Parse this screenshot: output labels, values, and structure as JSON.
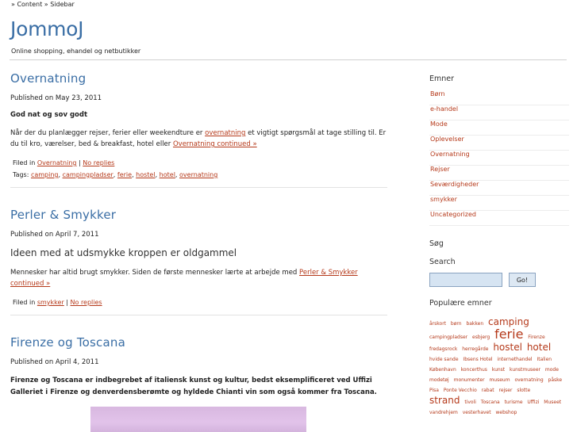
{
  "skip_links": "» Content » Sidebar",
  "site": {
    "title": "JommoJ",
    "tagline": "Online shopping, ehandel og netbutikker"
  },
  "posts": [
    {
      "title": "Overnatning",
      "date": "Published on May 23, 2011",
      "subtitle": "God nat og sov godt",
      "text": "Når der du planlægger rejser, ferier eller weekendture er ",
      "text_link": "overnatning",
      "text2": " et vigtigt spørgsmål at tage stilling til. Er du til kro, værelser, bed & breakfast, hotel eller ",
      "continue": "Overnatning continued »",
      "filed_prefix": "Filed in ",
      "category": "Overnatning",
      "sep": " | ",
      "replies": "No replies",
      "tags_prefix": "Tags: ",
      "tags": [
        "camping",
        "campingpladser",
        "ferie",
        "hostel",
        "hotel",
        "overnatning"
      ]
    },
    {
      "title": "Perler & Smykker",
      "date": "Published on April 7, 2011",
      "subtitle": "Ideen med at udsmykke kroppen er oldgammel",
      "text": "Mennesker har altid brugt smykker. Siden de første mennesker lærte at arbejde med ",
      "continue": "Perler & Smykker continued »",
      "filed_prefix": "Filed in ",
      "category": "smykker",
      "sep": " | ",
      "replies": "No replies"
    },
    {
      "title": "Firenze og Toscana",
      "date": "Published on April 4, 2011",
      "text": "Firenze og Toscana er indbegrebet af italiensk kunst og kultur, bedst eksemplificeret ved Uffizi Galleriet i Firenze og denverdensberømte og hyldede Chianti vin som også kommer fra Toscana."
    }
  ],
  "sidebar": {
    "categories_heading": "Emner",
    "categories": [
      "Børn",
      "e-handel",
      "Mode",
      "Oplevelser",
      "Overnatning",
      "Rejser",
      "Seværdigheder",
      "smykker",
      "Uncategorized"
    ],
    "search_heading": "Søg",
    "search_label": "Search",
    "search_button": "Go!",
    "search_placeholder": "",
    "tags_heading": "Populære emner",
    "tagcloud": [
      {
        "t": "årskort",
        "s": 1
      },
      {
        "t": "børn",
        "s": 1
      },
      {
        "t": "bakken",
        "s": 1
      },
      {
        "t": "camping",
        "s": 3
      },
      {
        "t": "campingpladser",
        "s": 1
      },
      {
        "t": "esbjerg",
        "s": 1
      },
      {
        "t": "ferie",
        "s": 4
      },
      {
        "t": "Firenze",
        "s": 1
      },
      {
        "t": "fredagsrock",
        "s": 1
      },
      {
        "t": "herregårde",
        "s": 1
      },
      {
        "t": "hostel",
        "s": 3
      },
      {
        "t": "hotel",
        "s": 3
      },
      {
        "t": "hvide sande",
        "s": 1
      },
      {
        "t": "Ibsens Hotel",
        "s": 1
      },
      {
        "t": "internethandel",
        "s": 1
      },
      {
        "t": "Italien",
        "s": 1
      },
      {
        "t": "København",
        "s": 1
      },
      {
        "t": "koncerthus",
        "s": 1
      },
      {
        "t": "kunst",
        "s": 1
      },
      {
        "t": "kunstmuseer",
        "s": 1
      },
      {
        "t": "mode",
        "s": 1
      },
      {
        "t": "modetøj",
        "s": 1
      },
      {
        "t": "monumenter",
        "s": 1
      },
      {
        "t": "museum",
        "s": 1
      },
      {
        "t": "overnatning",
        "s": 1
      },
      {
        "t": "påske",
        "s": 1
      },
      {
        "t": "Pisa",
        "s": 1
      },
      {
        "t": "Ponte Vecchio",
        "s": 1
      },
      {
        "t": "rabat",
        "s": 1
      },
      {
        "t": "rejser",
        "s": 1
      },
      {
        "t": "slotte",
        "s": 1
      },
      {
        "t": "strand",
        "s": 3
      },
      {
        "t": "tivoli",
        "s": 1
      },
      {
        "t": "Toscana",
        "s": 1
      },
      {
        "t": "turisme",
        "s": 1
      },
      {
        "t": "Uffizi",
        "s": 1
      },
      {
        "t": "Museet",
        "s": 1
      },
      {
        "t": "vandrehjem",
        "s": 1
      },
      {
        "t": "vesterhavet",
        "s": 1
      },
      {
        "t": "webshop",
        "s": 1
      }
    ]
  },
  "colors": {
    "link": "#b5391a",
    "title": "#3a6ea5"
  }
}
